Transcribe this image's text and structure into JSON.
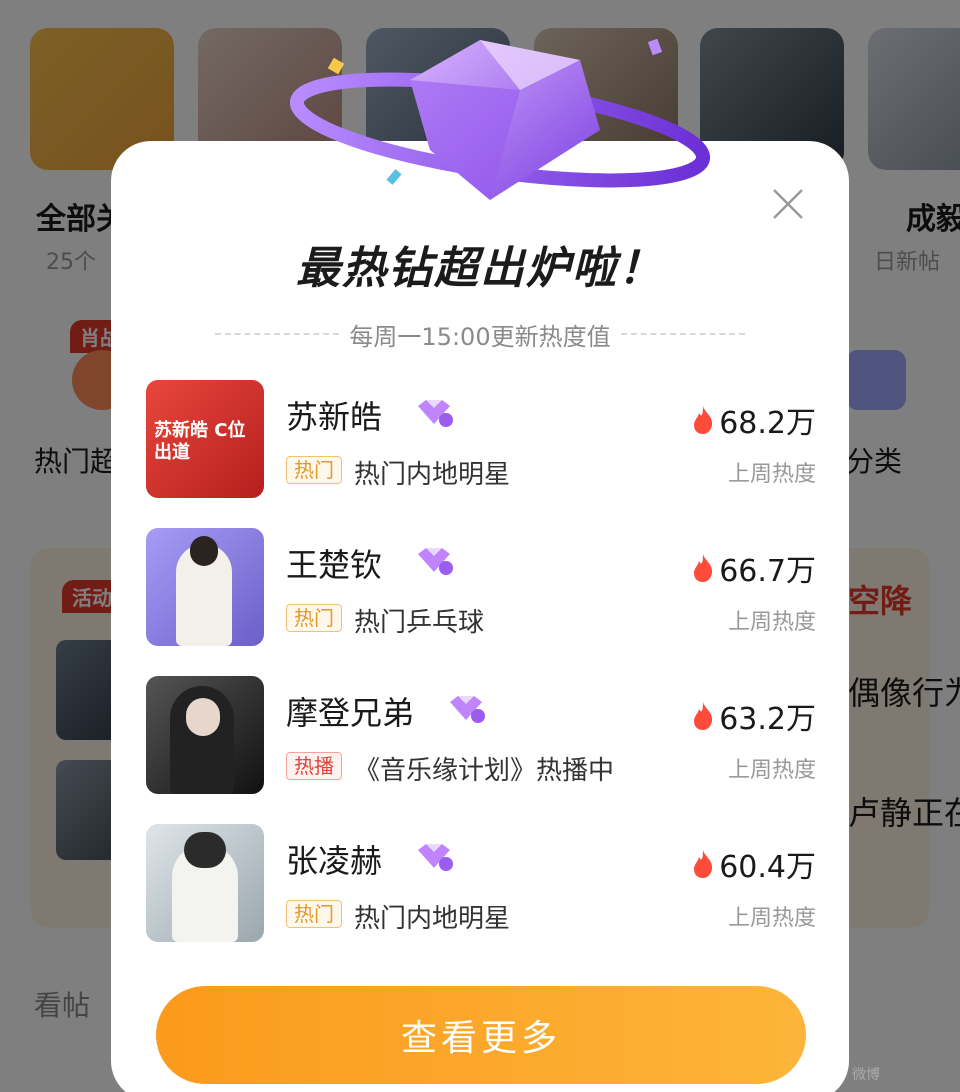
{
  "background": {
    "categories": [
      {
        "title": "全部关",
        "sub": "25个"
      },
      {
        "title": "成毅",
        "sub": "日新帖"
      }
    ],
    "row2": [
      {
        "label": "热门超",
        "badge": "肖战"
      },
      {
        "label": "分类"
      }
    ],
    "activity_badge": "活动",
    "side_texts": [
      "空降",
      "偶像行为",
      "卢静正在"
    ],
    "bottom_label": "看帖"
  },
  "dialog": {
    "headline": "最热钻超出炉啦！",
    "subline": "每周一15:00更新热度值",
    "close_icon": "close-icon",
    "items": [
      {
        "name": "苏新皓",
        "tag": "热门",
        "tag_type": "hot",
        "desc": "热门内地明星",
        "heat": "68.2万",
        "heat_label": "上周热度",
        "avatar_text": "苏新皓 C位出道"
      },
      {
        "name": "王楚钦",
        "tag": "热门",
        "tag_type": "hot",
        "desc": "热门乒乓球",
        "heat": "66.7万",
        "heat_label": "上周热度"
      },
      {
        "name": "摩登兄弟",
        "tag": "热播",
        "tag_type": "play",
        "desc": "《音乐缘计划》热播中",
        "heat": "63.2万",
        "heat_label": "上周热度"
      },
      {
        "name": "张凌赫",
        "tag": "热门",
        "tag_type": "hot",
        "desc": "热门内地明星",
        "heat": "60.4万",
        "heat_label": "上周热度"
      }
    ],
    "more_button": "查看更多"
  },
  "watermark": "微博"
}
